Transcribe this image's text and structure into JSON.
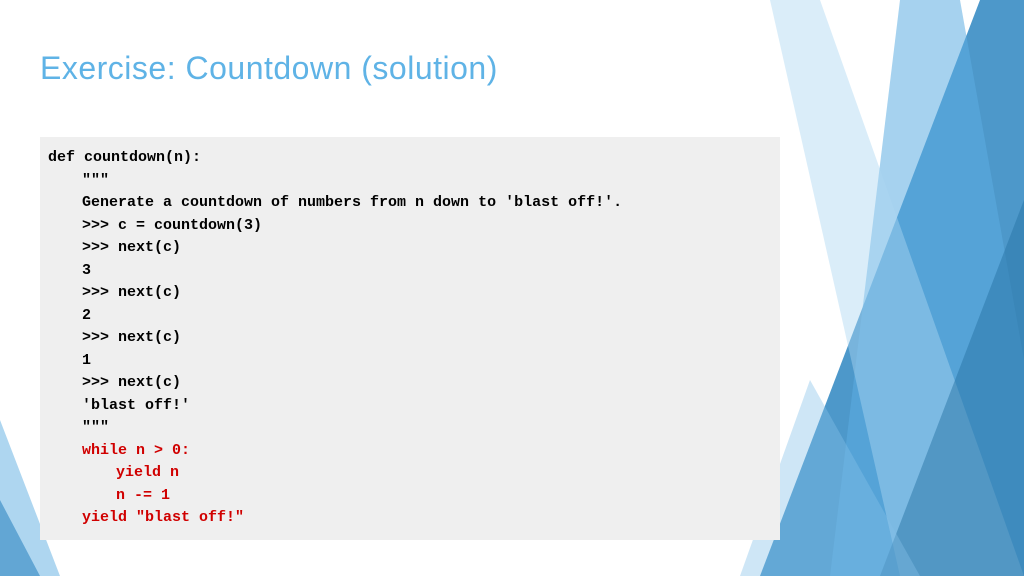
{
  "slide": {
    "title": "Exercise: Countdown (solution)"
  },
  "code": {
    "lines": [
      {
        "text": "def countdown(n):",
        "indent": 0,
        "colored": false
      },
      {
        "text": "\"\"\"",
        "indent": 1,
        "colored": false
      },
      {
        "text": "Generate a countdown of numbers from n down to 'blast off!'.",
        "indent": 1,
        "colored": false
      },
      {
        "text": ">>> c = countdown(3)",
        "indent": 1,
        "colored": false
      },
      {
        "text": ">>> next(c)",
        "indent": 1,
        "colored": false
      },
      {
        "text": "3",
        "indent": 1,
        "colored": false
      },
      {
        "text": ">>> next(c)",
        "indent": 1,
        "colored": false
      },
      {
        "text": "2",
        "indent": 1,
        "colored": false
      },
      {
        "text": ">>> next(c)",
        "indent": 1,
        "colored": false
      },
      {
        "text": "1",
        "indent": 1,
        "colored": false
      },
      {
        "text": ">>> next(c)",
        "indent": 1,
        "colored": false
      },
      {
        "text": "'blast off!'",
        "indent": 1,
        "colored": false
      },
      {
        "text": "\"\"\"",
        "indent": 1,
        "colored": false
      },
      {
        "text": "while n > 0:",
        "indent": 1,
        "colored": true
      },
      {
        "text": "yield n",
        "indent": 2,
        "colored": true
      },
      {
        "text": "n -= 1",
        "indent": 2,
        "colored": true
      },
      {
        "text": "yield \"blast off!\"",
        "indent": 1,
        "colored": true
      }
    ]
  }
}
